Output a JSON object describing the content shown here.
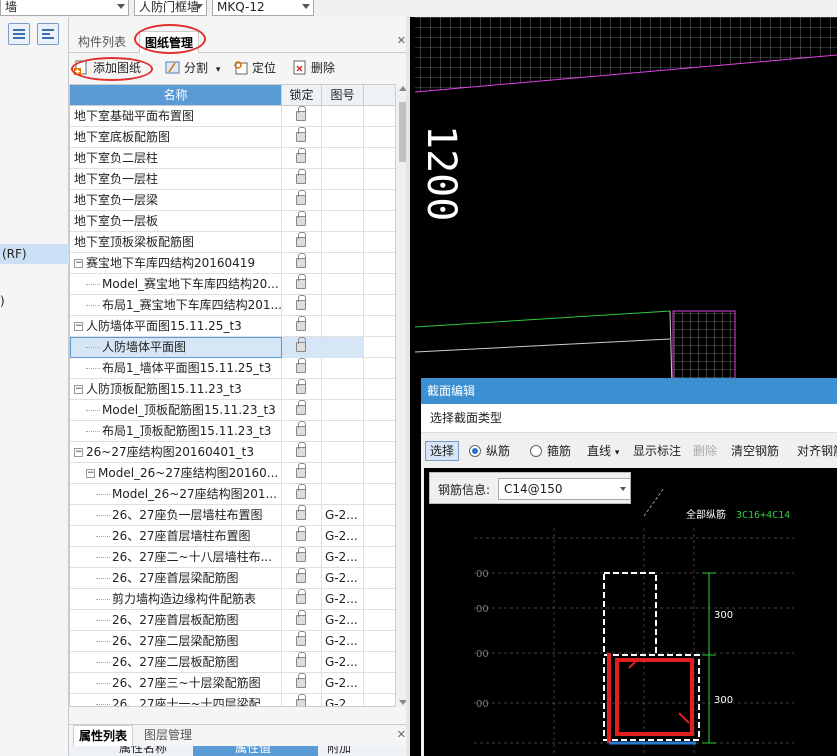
{
  "top_combos": [
    {
      "value": "墙"
    },
    {
      "value": "人防门框墙"
    },
    {
      "value": "MKQ-12"
    }
  ],
  "left_strip": {
    "selected_text": "(RF)",
    "other_text": ")"
  },
  "panel": {
    "tabs": [
      "构件列表",
      "图纸管理"
    ],
    "active_tab": "图纸管理",
    "toolbar": {
      "add": "添加图纸",
      "split": "分割",
      "locate": "定位",
      "delete": "删除"
    },
    "columns": [
      "名称",
      "锁定",
      "图号"
    ],
    "rows": [
      {
        "indent": 0,
        "expander": "",
        "name": "地下室基础平面布置图",
        "num": ""
      },
      {
        "indent": 0,
        "expander": "",
        "name": "地下室底板配筋图",
        "num": ""
      },
      {
        "indent": 0,
        "expander": "",
        "name": "地下室负二层柱",
        "num": ""
      },
      {
        "indent": 0,
        "expander": "",
        "name": "地下室负一层柱",
        "num": ""
      },
      {
        "indent": 0,
        "expander": "",
        "name": "地下室负一层梁",
        "num": ""
      },
      {
        "indent": 0,
        "expander": "",
        "name": "地下室负一层板",
        "num": ""
      },
      {
        "indent": 0,
        "expander": "",
        "name": "地下室顶板梁板配筋图",
        "num": ""
      },
      {
        "indent": 0,
        "expander": "−",
        "name": "赛宝地下车库四结构20160419",
        "num": ""
      },
      {
        "indent": 1,
        "expander": "",
        "name": "Model_赛宝地下车库四结构20...",
        "num": ""
      },
      {
        "indent": 1,
        "expander": "",
        "name": "布局1_赛宝地下车库四结构201...",
        "num": ""
      },
      {
        "indent": 0,
        "expander": "−",
        "name": "人防墙体平面图15.11.25_t3",
        "num": ""
      },
      {
        "indent": 1,
        "expander": "",
        "name": "人防墙体平面图",
        "num": "",
        "selected": true
      },
      {
        "indent": 1,
        "expander": "",
        "name": "布局1_墙体平面图15.11.25_t3",
        "num": ""
      },
      {
        "indent": 0,
        "expander": "−",
        "name": "人防顶板配筋图15.11.23_t3",
        "num": ""
      },
      {
        "indent": 1,
        "expander": "",
        "name": "Model_顶板配筋图15.11.23_t3",
        "num": ""
      },
      {
        "indent": 1,
        "expander": "",
        "name": "布局1_顶板配筋图15.11.23_t3",
        "num": ""
      },
      {
        "indent": 0,
        "expander": "−",
        "name": "26~27座结构图20160401_t3",
        "num": ""
      },
      {
        "indent": 1,
        "expander": "−",
        "name": "Model_26~27座结构图20160...",
        "num": ""
      },
      {
        "indent": 2,
        "expander": "",
        "name": "Model_26~27座结构图201...",
        "num": ""
      },
      {
        "indent": 2,
        "expander": "",
        "name": "26、27座负一层墙柱布置图",
        "num": "G-2..."
      },
      {
        "indent": 2,
        "expander": "",
        "name": "26、27座首层墙柱布置图",
        "num": "G-2..."
      },
      {
        "indent": 2,
        "expander": "",
        "name": "26、27座二~十八层墙柱布...",
        "num": "G-2..."
      },
      {
        "indent": 2,
        "expander": "",
        "name": "26、27座首层梁配筋图",
        "num": "G-2..."
      },
      {
        "indent": 2,
        "expander": "",
        "name": "剪力墙构造边缘构件配筋表",
        "num": "G-2..."
      },
      {
        "indent": 2,
        "expander": "",
        "name": "26、27座首层板配筋图",
        "num": "G-2..."
      },
      {
        "indent": 2,
        "expander": "",
        "name": "26、27座二层梁配筋图",
        "num": "G-2..."
      },
      {
        "indent": 2,
        "expander": "",
        "name": "26、27座二层板配筋图",
        "num": "G-2..."
      },
      {
        "indent": 2,
        "expander": "",
        "name": "26、27座三~十层梁配筋图",
        "num": "G-2..."
      },
      {
        "indent": 2,
        "expander": "",
        "name": "26、27座十一~十四层梁配",
        "num": "G-2..."
      }
    ],
    "bottom_tabs": [
      "属性列表",
      "图层管理"
    ],
    "bottom_columns": [
      "属性名称",
      "属性值",
      "附加"
    ]
  },
  "cad": {
    "dimension_text": "1200"
  },
  "section_editor": {
    "title": "截面编辑",
    "subtitle": "选择截面类型",
    "tools": {
      "select": "选择",
      "longitudinal": "纵筋",
      "stirrup": "箍筋",
      "straight": "直线",
      "show_label": "显示标注",
      "delete": "删除",
      "clear": "清空钢筋",
      "align": "对齐钢筋"
    },
    "rebar_info_label": "钢筋信息:",
    "rebar_info_value": "C14@150",
    "annotation_label": "全部纵筋",
    "annotation_value": "3C16+4C14",
    "dim_300_top": "300",
    "dim_300_bottom": "300",
    "grid_labels": [
      "00",
      "00",
      "00",
      "00"
    ]
  },
  "colors": {
    "accent": "#5b9bd5",
    "selection": "#d6e6f7",
    "annotation_red": "#e03030",
    "cad_magenta": "#e040e0",
    "cad_green": "#2ecc40"
  }
}
